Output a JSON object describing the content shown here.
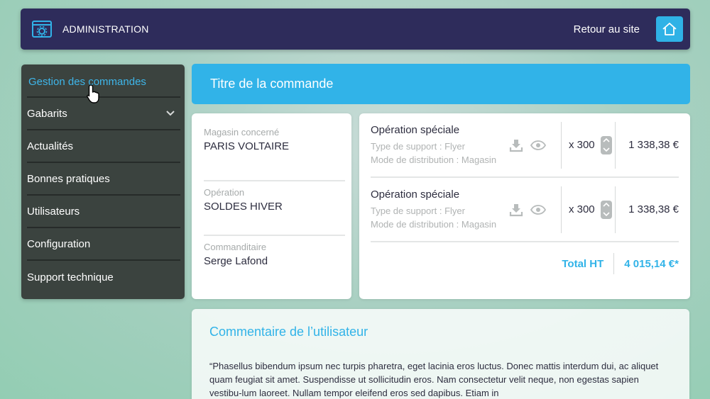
{
  "header": {
    "brand": "ADMINISTRATION",
    "back_label": "Retour au site"
  },
  "sidebar": {
    "items": [
      {
        "label": "Gestion des commandes",
        "active": true
      },
      {
        "label": "Gabarits",
        "has_chevron": true
      },
      {
        "label": "Actualités"
      },
      {
        "label": "Bonnes pratiques"
      },
      {
        "label": "Utilisateurs"
      },
      {
        "label": "Configuration"
      },
      {
        "label": "Support technique"
      }
    ]
  },
  "main": {
    "title": "Titre de la commande",
    "info": {
      "fields": [
        {
          "label": "Magasin concerné",
          "value": "PARIS VOLTAIRE"
        },
        {
          "label": "Opération",
          "value": "SOLDES HIVER"
        },
        {
          "label": "Commanditaire",
          "value": "Serge Lafond"
        }
      ]
    },
    "order": {
      "lines": [
        {
          "name": "Opération spéciale",
          "support": "Type de support : Flyer",
          "distribution": "Mode de distribution : Magasin",
          "quantity": "x 300",
          "price": "1 338,38 €"
        },
        {
          "name": "Opération spéciale",
          "support": "Type de support : Flyer",
          "distribution": "Mode de distribution : Magasin",
          "quantity": "x 300",
          "price": "1 338,38 €"
        }
      ],
      "total_label": "Total HT",
      "total_value": "4 015,14 €*"
    },
    "comment": {
      "title": "Commentaire de l’utilisateur",
      "text": "“Phasellus bibendum ipsum nec turpis pharetra, eget lacinia eros luctus. Donec mattis interdum dui, ac aliquet quam feugiat sit amet. Suspendisse ut sollicitudin eros. Nam consectetur velit neque, non egestas sapien vestibu-lum laoreet. Nullam tempor eleifend eros sed dapibus. Etiam in"
    }
  },
  "colors": {
    "accent": "#31b3e8",
    "header_bg": "#2e2c5b",
    "sidebar_bg": "#3b433f"
  },
  "icons": [
    "admin-gear-icon",
    "home-icon",
    "chevron-down-icon",
    "download-icon",
    "eye-icon",
    "stepper-arrows-icon",
    "pointer-cursor-icon"
  ]
}
